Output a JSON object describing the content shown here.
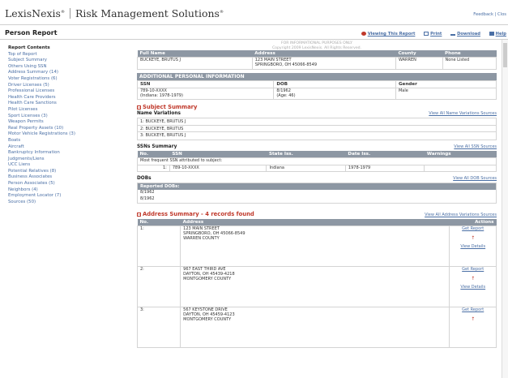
{
  "header": {
    "brand": "LexisNexis",
    "tm": "®",
    "product": "Risk Management Solutions",
    "product_tm": "®",
    "links": "Feedback | Clos"
  },
  "page": {
    "title": "Person Report",
    "actions": [
      "Viewing This Report",
      "Print",
      "Download",
      "Help"
    ]
  },
  "sidebar": {
    "heading": "Report Contents",
    "items": [
      "Top of Report",
      "Subject Summary",
      "Others Using SSN",
      "Address Summary (14)",
      "Voter Registrations (6)",
      "Driver Licenses (5)",
      "Professional Licenses",
      "Health Care Providers",
      "Health Care Sanctions",
      "Pilot Licenses",
      "Sport Licenses (3)",
      "Weapon Permits",
      "Real Property Assets (10)",
      "Motor Vehicle Registrations (3)",
      "Boats",
      "Aircraft",
      "Bankruptcy Information",
      "Judgments/Liens",
      "UCC Liens",
      "Potential Relatives (8)",
      "Business Associates",
      "Person Associates (5)",
      "Neighbors (4)",
      "Employment Locator (7)",
      "Sources (50)"
    ]
  },
  "notice": {
    "line1": "FOR INFORMATIONAL PURPOSES ONLY",
    "line2": "Copyright 2009 LexisNexis. All Rights Reserved."
  },
  "person_table": {
    "headers": [
      "Full Name",
      "Address",
      "County",
      "Phone"
    ],
    "row": {
      "name": "BUCKEYE, BRUTUS J",
      "address1": "123 MAIN STREET",
      "address2": "SPRINGBORO, OH 45066-8549",
      "county": "WARREN",
      "phone": "None Listed"
    }
  },
  "additional": {
    "title": "ADDITIONAL PERSONAL INFORMATION",
    "headers": [
      "SSN",
      "DOB",
      "Gender"
    ],
    "ssn": "789-10-XXXX",
    "ssn_sub": "(Indiana: 1978-1979)",
    "dob": "8/1962",
    "dob_sub": "(Age: 46)",
    "gender": "Male"
  },
  "subject_summary": {
    "title": "Subject Summary",
    "name_variations_label": "Name Variations",
    "name_variations_link": "View All Name Variations Sources",
    "names": [
      "1: BUCKEYE, BRUTUS J",
      "2: BUCKEYE, BRUTUS",
      "3: BUCKEYE, BRUTUS J"
    ]
  },
  "ssns": {
    "title": "SSNs Summary",
    "link": "View All SSN Sources",
    "headers": [
      "No.",
      "SSN",
      "State Iss.",
      "Date Iss.",
      "Warnings"
    ],
    "note": "Most frequent SSN attributed to subject:",
    "row": {
      "no": "1:",
      "ssn": "789-10-XXXX",
      "state": "Indiana",
      "date": "1978-1979",
      "warnings": ""
    }
  },
  "dobs": {
    "title": "DOBs",
    "link": "View All DOB Sources",
    "header": "Reported DOBs:",
    "values": [
      "8/1962",
      "8/1962"
    ]
  },
  "address_summary": {
    "title": "Address Summary - 4 records found",
    "link": "View All Address Variations Sources",
    "headers": [
      "No.",
      "Address",
      "Actions"
    ],
    "get_report": "Get Report",
    "view_details": "View Details",
    "rows": [
      {
        "no": "1:",
        "line1": "123 MAIN STREET",
        "line2": "SPRINGBORO, OH 45066-8549",
        "line3": "WARREN COUNTY"
      },
      {
        "no": "2:",
        "line1": "967 EAST THIRD AVE",
        "line2": "DAYTON, OH 45439-4218",
        "line3": "MONTGOMERY COUNTY"
      },
      {
        "no": "3:",
        "line1": "567 KEYSTONE DRIVE",
        "line2": "DAYTON, OH 45459-4123",
        "line3": "MONTGOMERY COUNTY"
      }
    ]
  }
}
